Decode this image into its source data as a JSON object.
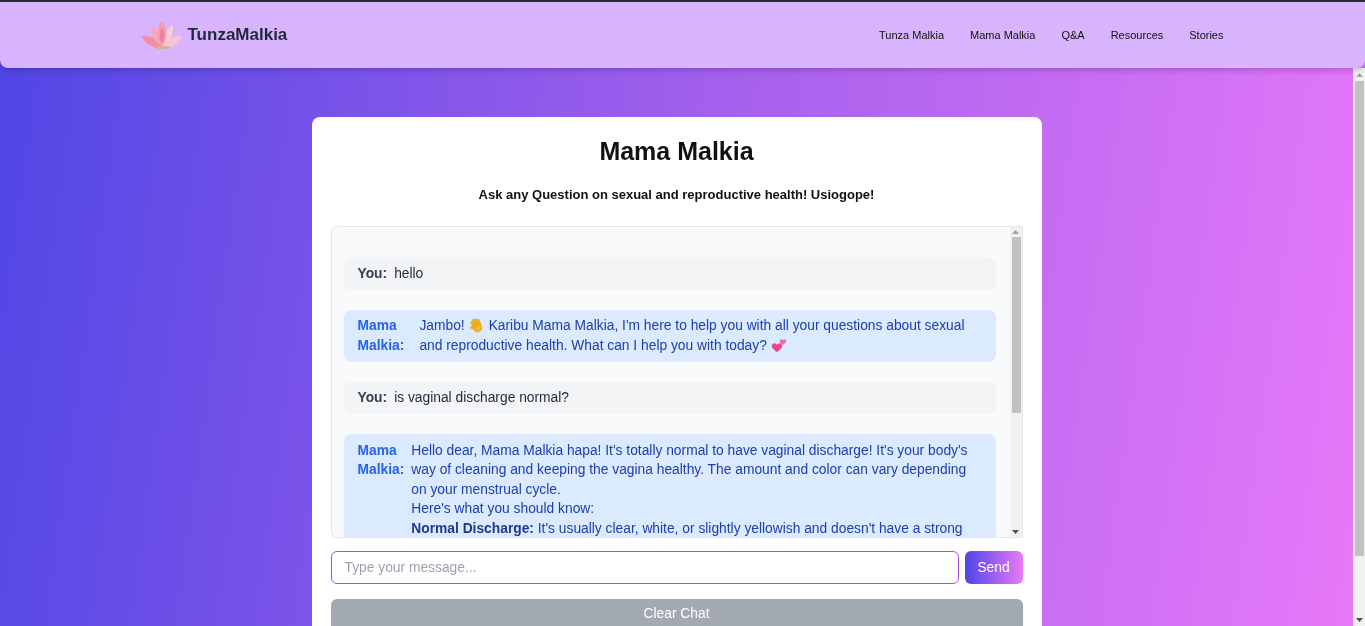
{
  "header": {
    "brand": "TunzaMalkia",
    "nav": [
      {
        "label": "Tunza Malkia"
      },
      {
        "label": "Mama Malkia"
      },
      {
        "label": "Q&A"
      },
      {
        "label": "Resources"
      },
      {
        "label": "Stories"
      }
    ]
  },
  "chat": {
    "title": "Mama Malkia",
    "subtitle": "Ask any Question on sexual and reproductive health! Usiogope!",
    "messages": [
      {
        "kind": "user",
        "sender": "You:",
        "paragraphs": [
          {
            "parts": [
              {
                "kind": "text",
                "text": "hello"
              }
            ]
          }
        ]
      },
      {
        "kind": "bot",
        "sender": "Mama Malkia:",
        "paragraphs": [
          {
            "parts": [
              {
                "kind": "text",
                "text": "Jambo!"
              },
              {
                "kind": "wave"
              },
              {
                "kind": "text",
                "text": "Karibu Mama Malkia, I'm here to help you with all your questions about sexual and reproductive health. What can I help you with today?"
              },
              {
                "kind": "hearts"
              }
            ]
          }
        ]
      },
      {
        "kind": "user",
        "sender": "You:",
        "paragraphs": [
          {
            "parts": [
              {
                "kind": "text",
                "text": "is vaginal discharge normal?"
              }
            ]
          }
        ]
      },
      {
        "kind": "bot",
        "sender": "Mama Malkia:",
        "paragraphs": [
          {
            "parts": [
              {
                "kind": "text",
                "text": "Hello dear, Mama Malkia hapa! It's totally normal to have vaginal discharge! It's your body's way of cleaning and keeping the vagina healthy. The amount and color can vary depending on your menstrual cycle."
              }
            ]
          },
          {
            "parts": [
              {
                "kind": "text",
                "text": "Here's what you should know:"
              }
            ]
          },
          {
            "parts": [
              {
                "kind": "text",
                "text": "**Normal Discharge:** It's usually clear, white, or slightly yellowish and doesn't have a strong"
              }
            ]
          }
        ]
      }
    ],
    "input": {
      "placeholder": "Type your message..."
    },
    "send_button": "Send",
    "clear_button": "Clear Chat"
  }
}
